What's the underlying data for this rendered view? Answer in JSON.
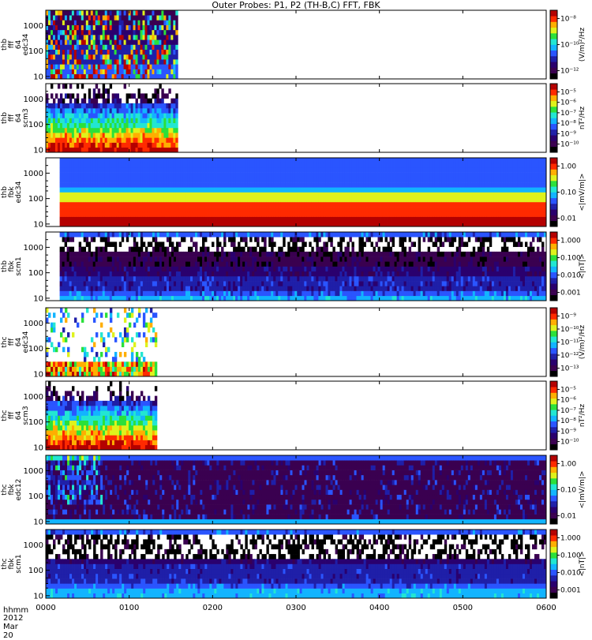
{
  "title": "Outer Probes: P1, P2 (TH-B,C) FFT, FBK",
  "x_axis": {
    "row_label_1": "hhmm",
    "row_label_2": "2012 Mar 20",
    "ticks": [
      "0000",
      "0100",
      "0200",
      "0300",
      "0400",
      "0500",
      "0600"
    ]
  },
  "colors": {
    "spectrogram_colormap": [
      "#000000",
      "#3a0050",
      "#2a006e",
      "#1f1fa8",
      "#2a55ff",
      "#12b4ff",
      "#22e6d2",
      "#2be03a",
      "#dff21c",
      "#ffae00",
      "#ff2a00",
      "#b40000"
    ]
  },
  "chart_data": [
    {
      "type": "heatmap",
      "ylabel": [
        "thb",
        "fff",
        "64",
        "edc34"
      ],
      "yticks": [
        "10",
        "100",
        "1000"
      ],
      "yscale": "log",
      "colorbar": {
        "ticks": [
          "10⁻⁸",
          "10⁻¹⁰",
          "10⁻¹²"
        ],
        "label": "(V/m)²/Hz",
        "scale": "log"
      },
      "data_extent_hhmm": [
        "0000",
        "0135"
      ],
      "pattern": "bursty"
    },
    {
      "type": "heatmap",
      "ylabel": [
        "thb",
        "fff",
        "64",
        "scm3"
      ],
      "yticks": [
        "10",
        "100",
        "1000"
      ],
      "yscale": "log",
      "colorbar": {
        "ticks": [
          "10⁻⁵",
          "10⁻⁶",
          "10⁻⁷",
          "10⁻⁸",
          "10⁻⁹",
          "10⁻¹⁰"
        ],
        "label": "nT²/Hz",
        "scale": "log"
      },
      "data_extent_hhmm": [
        "0000",
        "0135"
      ],
      "pattern": "bands_high_low"
    },
    {
      "type": "heatmap",
      "ylabel": [
        "thb",
        "fbk",
        "edc34"
      ],
      "yticks": [
        "10",
        "100",
        "1000"
      ],
      "yscale": "log",
      "colorbar": {
        "ticks": [
          "1.00",
          "0.10",
          "0.01"
        ],
        "label": "<|mV/m|>",
        "scale": "log"
      },
      "data_extent_hhmm": [
        "0010",
        "0600"
      ],
      "pattern": "edc_fbk"
    },
    {
      "type": "heatmap",
      "ylabel": [
        "thb",
        "fbk",
        "scm1"
      ],
      "yticks": [
        "10",
        "100",
        "1000"
      ],
      "yscale": "log",
      "colorbar": {
        "ticks": [
          "1.000",
          "0.100",
          "0.010",
          "0.001"
        ],
        "label": "<|nT|>",
        "scale": "log"
      },
      "data_extent_hhmm": [
        "0010",
        "0600"
      ],
      "pattern": "scm_fbk"
    },
    {
      "type": "heatmap",
      "ylabel": [
        "thc",
        "fff",
        "64",
        "edc34"
      ],
      "yticks": [
        "10",
        "100",
        "1000"
      ],
      "yscale": "log",
      "colorbar": {
        "ticks": [
          "10⁻⁹",
          "10⁻¹⁰",
          "10⁻¹¹",
          "10⁻¹²",
          "10⁻¹³"
        ],
        "label": "(V/m)²/Hz",
        "scale": "log"
      },
      "data_extent_hhmm": [
        "0000",
        "0120"
      ],
      "pattern": "sparse_bursty"
    },
    {
      "type": "heatmap",
      "ylabel": [
        "thc",
        "fff",
        "64",
        "scm3"
      ],
      "yticks": [
        "10",
        "100",
        "1000"
      ],
      "yscale": "log",
      "colorbar": {
        "ticks": [
          "10⁻⁵",
          "10⁻⁶",
          "10⁻⁷",
          "10⁻⁸",
          "10⁻⁹",
          "10⁻¹⁰"
        ],
        "label": "nT²/Hz",
        "scale": "log"
      },
      "data_extent_hhmm": [
        "0000",
        "0120"
      ],
      "pattern": "bands_high_low"
    },
    {
      "type": "heatmap",
      "ylabel": [
        "thc",
        "fbk",
        "edc12"
      ],
      "yticks": [
        "10",
        "100",
        "1000"
      ],
      "yscale": "log",
      "colorbar": {
        "ticks": [
          "1.00",
          "0.10",
          "0.01"
        ],
        "label": "<|mV/m|>",
        "scale": "log"
      },
      "data_extent_hhmm": [
        "0000",
        "0600"
      ],
      "pattern": "dark_fbk"
    },
    {
      "type": "heatmap",
      "ylabel": [
        "thc",
        "fbk",
        "scm1"
      ],
      "yticks": [
        "10",
        "100",
        "1000"
      ],
      "yscale": "log",
      "colorbar": {
        "ticks": [
          "1.000",
          "0.100",
          "0.010",
          "0.001"
        ],
        "label": "<|nT|>",
        "scale": "log"
      },
      "data_extent_hhmm": [
        "0000",
        "0600"
      ],
      "pattern": "dark_scm"
    }
  ]
}
